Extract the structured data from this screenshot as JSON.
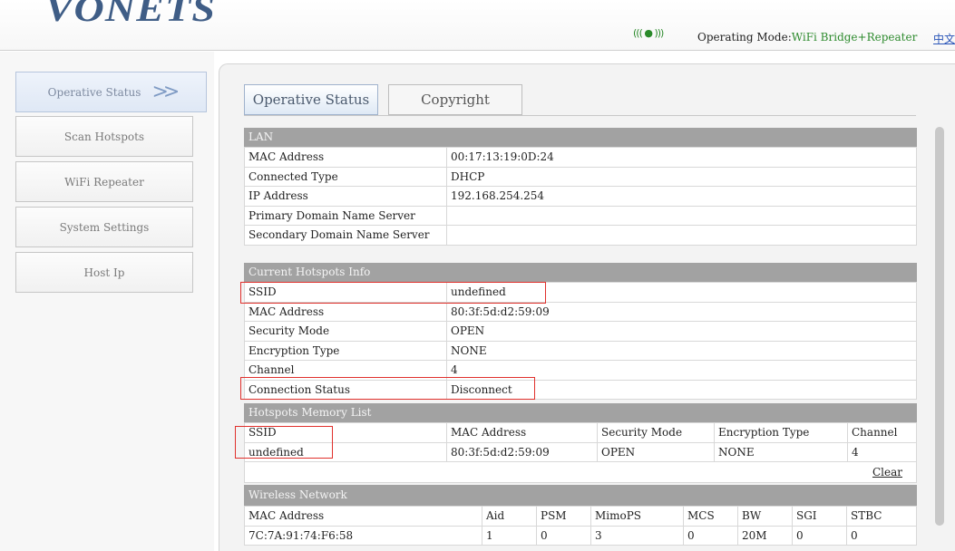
{
  "header": {
    "logo": "VONETS",
    "signal": "((( ● )))",
    "mode_label": "Operating Mode:",
    "mode_value": "WiFi Bridge+Repeater",
    "lang_link": "中文"
  },
  "sidebar": {
    "items": [
      {
        "label": "Operative Status",
        "active": true
      },
      {
        "label": "Scan Hotspots"
      },
      {
        "label": "WiFi Repeater"
      },
      {
        "label": "System Settings"
      },
      {
        "label": "Host Ip"
      }
    ]
  },
  "tabs": [
    {
      "label": "Operative Status",
      "active": true
    },
    {
      "label": "Copyright"
    }
  ],
  "lan": {
    "title": "LAN",
    "rows": [
      {
        "k": "MAC Address",
        "v": "00:17:13:19:0D:24"
      },
      {
        "k": "Connected Type",
        "v": "DHCP"
      },
      {
        "k": "IP Address",
        "v": "192.168.254.254"
      },
      {
        "k": "Primary Domain Name Server",
        "v": ""
      },
      {
        "k": "Secondary Domain Name Server",
        "v": ""
      }
    ]
  },
  "hotspot": {
    "title": "Current Hotspots Info",
    "rows": [
      {
        "k": "SSID",
        "v": "undefined"
      },
      {
        "k": "MAC Address",
        "v": "80:3f:5d:d2:59:09"
      },
      {
        "k": "Security Mode",
        "v": "OPEN"
      },
      {
        "k": "Encryption Type",
        "v": "NONE"
      },
      {
        "k": "Channel",
        "v": "4"
      },
      {
        "k": "Connection Status",
        "v": "Disconnect"
      }
    ]
  },
  "memory": {
    "title": "Hotspots Memory List",
    "columns": [
      "SSID",
      "MAC Address",
      "Security Mode",
      "Encryption Type",
      "Channel"
    ],
    "rows": [
      [
        "undefined",
        "80:3f:5d:d2:59:09",
        "OPEN",
        "NONE",
        "4"
      ]
    ],
    "clear_label": "Clear"
  },
  "wireless": {
    "title": "Wireless Network",
    "columns": [
      "MAC Address",
      "Aid",
      "PSM",
      "MimoPS",
      "MCS",
      "BW",
      "SGI",
      "STBC"
    ],
    "rows": [
      [
        "7C:7A:91:74:F6:58",
        "1",
        "0",
        "3",
        "0",
        "20M",
        "0",
        "0"
      ]
    ]
  },
  "colors": {
    "accent_green": "#2e8b2e",
    "highlight_red": "#e0302c",
    "section_header": "#a2a2a2"
  }
}
